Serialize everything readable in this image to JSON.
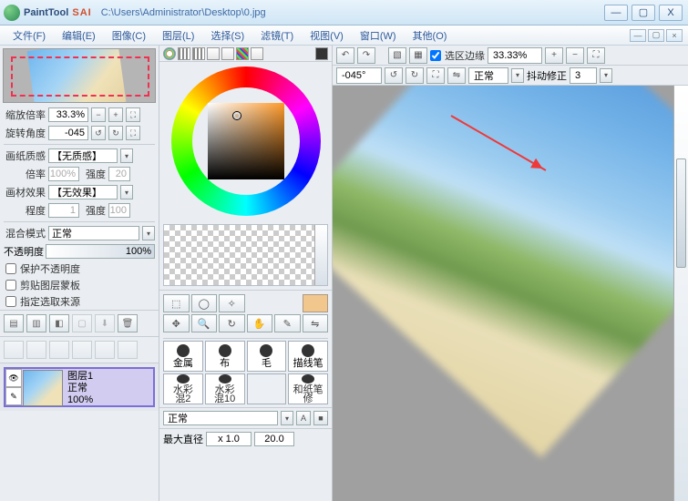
{
  "title": {
    "app": "PaintTool",
    "app2": " SAI",
    "path": "C:\\Users\\Administrator\\Desktop\\0.jpg"
  },
  "win": {
    "min": "—",
    "max": "▢",
    "close": "X"
  },
  "menu": {
    "items": [
      "文件(F)",
      "编辑(E)",
      "图像(C)",
      "图层(L)",
      "选择(S)",
      "滤镜(T)",
      "视图(V)",
      "窗口(W)",
      "其他(O)"
    ],
    "min": "—",
    "max": "▢",
    "close": "×"
  },
  "nav": {
    "zoom_label": "缩放倍率",
    "zoom": "33.3%",
    "rot_label": "旋转角度",
    "rot": "-045"
  },
  "params": {
    "tex_label": "画纸质感",
    "tex": "【无质感】",
    "scale_label": "倍率",
    "scale": "100%",
    "strength_label": "强度",
    "strength": "20",
    "effect_label": "画材效果",
    "effect": "【无效果】",
    "deg_label": "程度",
    "deg": "1",
    "deg_s_label": "强度",
    "deg_s": "100"
  },
  "blend": {
    "label": "混合模式",
    "mode": "正常",
    "op_label": "不透明度",
    "op": "100%"
  },
  "checks": {
    "c1": "保护不透明度",
    "c2": "剪贴图层蒙板",
    "c3": "指定选取来源"
  },
  "layers": {
    "name": "图层1",
    "mode": "正常",
    "op": "100%"
  },
  "toolbar": {
    "sel_edge": "选区边缘",
    "zoom": "33.33%",
    "angle": "-045°",
    "mode": "正常",
    "stab_label": "抖动修正",
    "stab": "3"
  },
  "brushes": {
    "p1": "金属",
    "p2": "布",
    "p3": "毛",
    "p4": "描线笔",
    "p5a": "水彩",
    "p5b": "混2",
    "p6a": "水彩",
    "p6b": "混10",
    "p7": "",
    "p8a": "和纸笔",
    "p8b": "修"
  },
  "brush_mode": {
    "mode": "正常"
  },
  "maxd": {
    "label": "最大直径",
    "mul": "x 1.0",
    "val": "20.0"
  },
  "icons": {
    "undo": "↶",
    "redo": "↷",
    "sel": "▦",
    "desel": "▧",
    "plus": "+",
    "minus": "−",
    "fit": "⛶",
    "rotl": "↺",
    "rotr": "↻",
    "flip": "⇋",
    "layer_new": "▤",
    "layer_fold": "▥",
    "layer_mask": "◧",
    "layer_del": "🗑",
    "layer_merge": "⬇",
    "layer_clear": "▢",
    "eye": "👁",
    "pen": "✎",
    "t_sel": "⬚",
    "t_lasso": "◯",
    "t_wand": "✧",
    "t_move": "✥",
    "t_zoom": "🔍",
    "t_rot": "↻",
    "t_hand": "✋",
    "t_pick": "✎",
    "t_brush": "✒",
    "t_fill": "▰"
  }
}
